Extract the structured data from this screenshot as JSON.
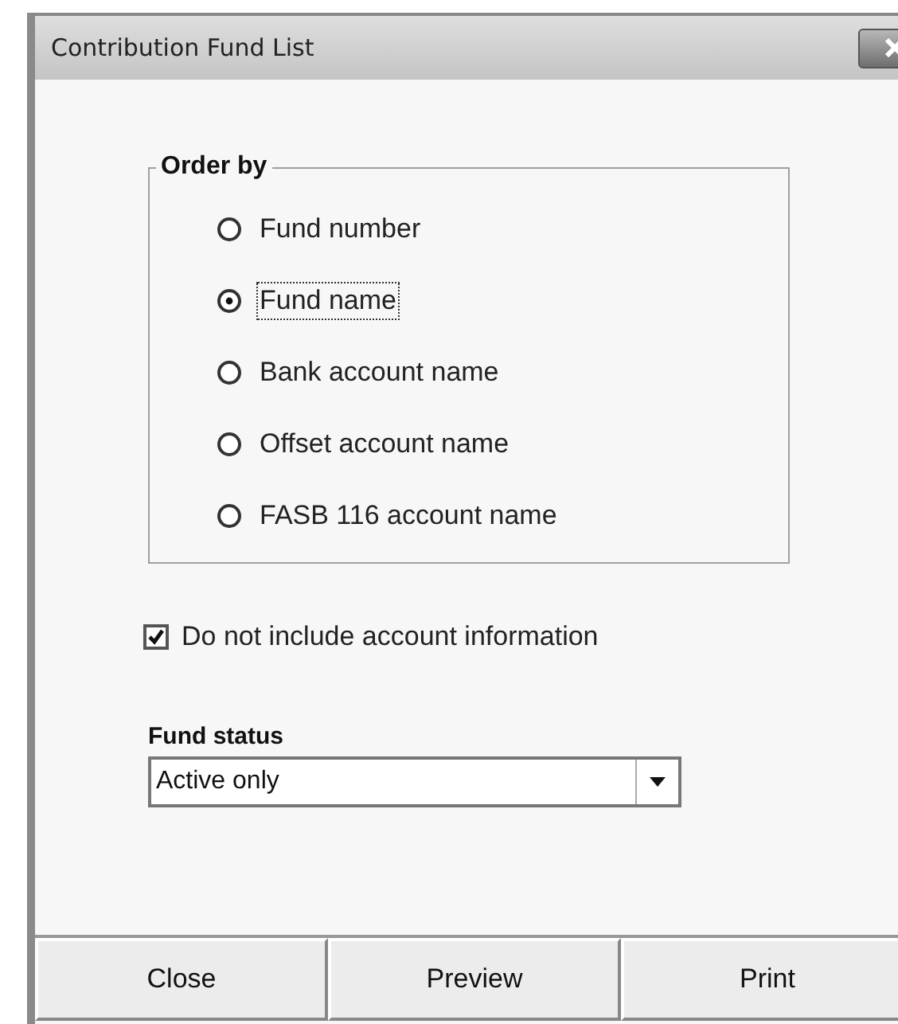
{
  "window": {
    "title": "Contribution Fund List"
  },
  "order_by": {
    "title": "Order by",
    "options": [
      {
        "label": "Fund number",
        "selected": false
      },
      {
        "label": "Fund name",
        "selected": true
      },
      {
        "label": "Bank account name",
        "selected": false
      },
      {
        "label": "Offset account name",
        "selected": false
      },
      {
        "label": "FASB 116 account name",
        "selected": false
      }
    ]
  },
  "exclude_account_info": {
    "label": "Do not include account information",
    "checked": true
  },
  "fund_status": {
    "label": "Fund status",
    "value": "Active only"
  },
  "buttons": [
    "Close",
    "Preview",
    "Print"
  ]
}
